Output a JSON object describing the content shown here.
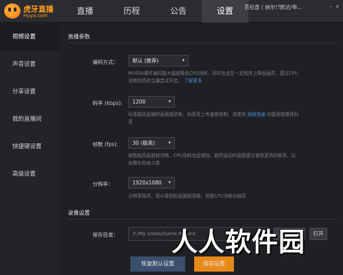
{
  "brand": {
    "title": "虎牙直播",
    "subtitle": "Huya.com",
    "accent": "#ff9b1e"
  },
  "nav": {
    "tabs": [
      "直播",
      "历程",
      "公告",
      "设置"
    ],
    "active": "设置"
  },
  "user": {
    "text": "丢拉直 ( 纳尔!?欧达/帝..."
  },
  "window_controls": [
    "–",
    "×"
  ],
  "sidebar": {
    "items": [
      "视频设置",
      "声音设置",
      "分享设置",
      "我的直播间",
      "快捷键设置",
      "高级设置"
    ],
    "active": "视频设置"
  },
  "live": {
    "section_title": "直播参数",
    "encoder": {
      "label": "编码方式：",
      "value": "默认 (推荐)",
      "desc": "NVIDIA硬件编码能大幅度降低CPU消耗，同时也会在一定程序上降低画质，建议CPU消耗较高的主播尝试开启。",
      "link": "了解更多"
    },
    "bitrate": {
      "label": "码率 (kbps):",
      "value": "1200",
      "desc": "码率越高直播的画面越清晰，码率受上传速度限制，请使用",
      "link": "网络测速",
      "desc_tail": "功能获取推荐码率"
    },
    "fps": {
      "label": "帧数 (fps):",
      "value": "30 (极高)",
      "desc": "帧数越高画面越流畅，CPU消耗也会增加，剧烈运动的画面建议使用更高的帧率，比如赛车和格斗类"
    },
    "resolution": {
      "label": "分辨率：",
      "value": "1920x1080",
      "desc": "分辨率越高，观众看到的画面越清晰，但是CPU消耗也越高"
    }
  },
  "record": {
    "section_title": "录像设置",
    "path_label": "保存目录：",
    "path_value": "F:/My Video/Game Record",
    "change_dir": "更改目录",
    "open": "打开"
  },
  "footer": {
    "reset": "恢复默认设置",
    "save": "保存设置"
  },
  "watermark": "人人软件园"
}
